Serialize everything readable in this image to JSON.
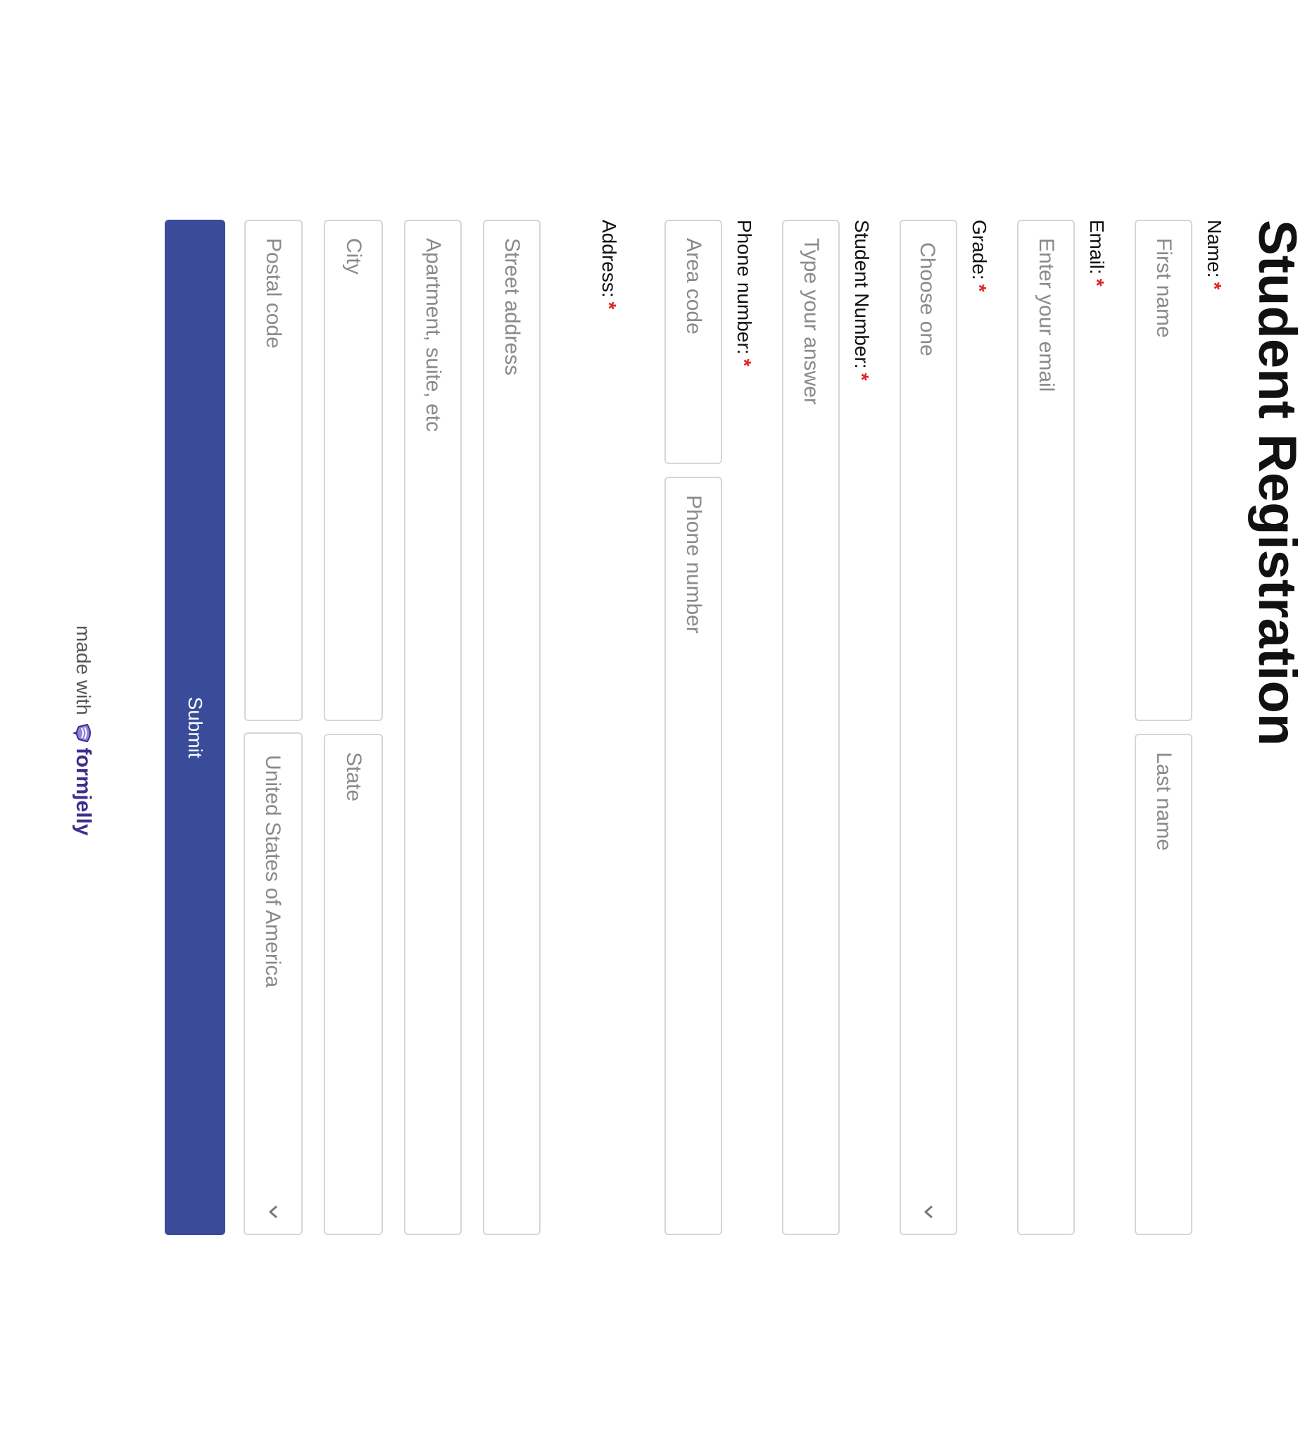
{
  "form": {
    "title": "Student Registration",
    "required_marker": "*",
    "name": {
      "label": "Name:",
      "first_placeholder": "First name",
      "last_placeholder": "Last name"
    },
    "email": {
      "label": "Email:",
      "placeholder": "Enter your email"
    },
    "grade": {
      "label": "Grade:",
      "selected_text": "Choose one",
      "icon": "chevron-down-icon"
    },
    "student_number": {
      "label": "Student Number:",
      "placeholder": "Type your answer"
    },
    "phone": {
      "label": "Phone number:",
      "area_placeholder": "Area code",
      "number_placeholder": "Phone number"
    },
    "address": {
      "label": "Address:",
      "street_placeholder": "Street address",
      "apartment_placeholder": "Apartment, suite, etc",
      "city_placeholder": "City",
      "state_placeholder": "State",
      "postal_placeholder": "Postal code",
      "country_selected": "United States of America"
    },
    "submit_label": "Submit"
  },
  "footer": {
    "made_with": "made with",
    "brand": "formjelly",
    "logo_icon": "formjelly-logo-icon"
  },
  "colors": {
    "accent": "#394b99",
    "required": "#e02424",
    "brand": "#3b2f8f",
    "border": "#d6d6d6",
    "placeholder": "#8a8a8a"
  }
}
